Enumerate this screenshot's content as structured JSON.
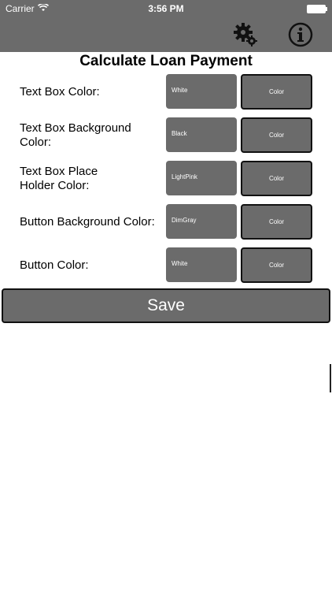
{
  "status_bar": {
    "carrier": "Carrier",
    "time": "3:56 PM"
  },
  "nav": {
    "settings_icon": "gear-icon",
    "info_icon": "info-icon"
  },
  "page": {
    "title": "Calculate Loan Payment"
  },
  "rows": [
    {
      "label": "Text Box Color:",
      "value": "White",
      "button": "Color"
    },
    {
      "label": "Text Box Background Color:",
      "value": "Black",
      "button": "Color"
    },
    {
      "label": "Text Box Place Holder Color:",
      "value": "LightPink",
      "button": "Color"
    },
    {
      "label": "Button Background Color:",
      "value": "DimGray",
      "button": "Color"
    },
    {
      "label": "Button Color:",
      "value": "White",
      "button": "Color"
    }
  ],
  "save": {
    "label": "Save"
  },
  "colors": {
    "bar": "#6b6b6b",
    "box": "#6b6b6b",
    "text_on_dark": "#ffffff"
  }
}
